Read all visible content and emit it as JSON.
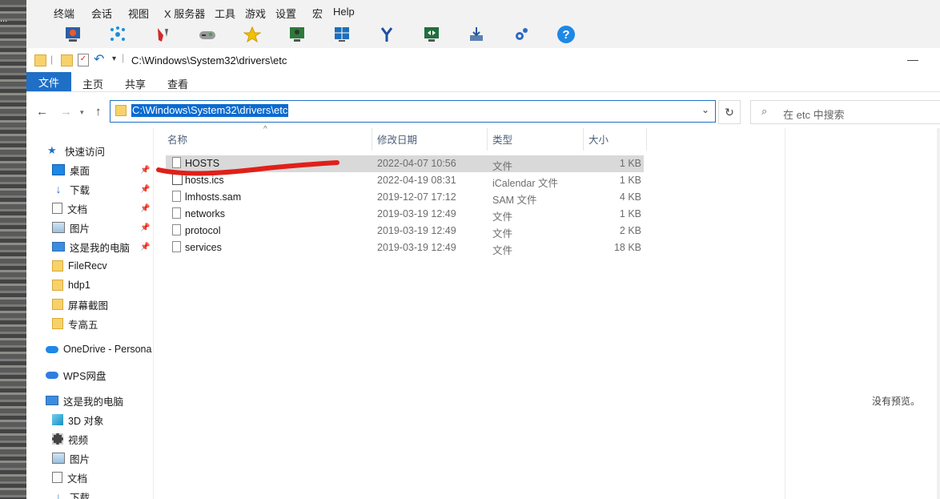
{
  "app_menu": [
    "终端",
    "会话",
    "视图",
    "X 服务器",
    "工具",
    "游戏",
    "设置",
    "宏",
    "Help"
  ],
  "app_toolbar_icons": [
    "session-icon",
    "network-icon",
    "tools-icon",
    "games-icon",
    "star-icon",
    "monitor-user-icon",
    "split-icon",
    "fork-icon",
    "remote-desktop-icon",
    "download-icon",
    "settings-icon",
    "help-icon"
  ],
  "window": {
    "title_path": "C:\\Windows\\System32\\drivers\\etc",
    "minimize_glyph": "—"
  },
  "ribbon": {
    "tabs": [
      "文件",
      "主页",
      "共享",
      "查看"
    ]
  },
  "address": {
    "path": "C:\\Windows\\System32\\drivers\\etc",
    "search_placeholder": "在 etc 中搜索"
  },
  "nav": {
    "quick_access": "快速访问",
    "quick_items": [
      {
        "label": "桌面",
        "icon": "desktop-icon",
        "pinned": true
      },
      {
        "label": "下载",
        "icon": "download-arrow-icon",
        "pinned": true
      },
      {
        "label": "文档",
        "icon": "document-icon",
        "pinned": true
      },
      {
        "label": "图片",
        "icon": "picture-icon",
        "pinned": true
      },
      {
        "label": "这是我的电脑",
        "icon": "computer-icon",
        "pinned": true
      },
      {
        "label": "FileRecv",
        "icon": "folder-icon",
        "pinned": false
      },
      {
        "label": "hdp1",
        "icon": "folder-icon",
        "pinned": false
      },
      {
        "label": "屏幕截图",
        "icon": "folder-icon",
        "pinned": false
      },
      {
        "label": "专高五",
        "icon": "folder-icon",
        "pinned": false
      }
    ],
    "onedrive": "OneDrive - Persona",
    "wps": "WPS网盘",
    "this_pc": "这是我的电脑",
    "pc_items": [
      {
        "label": "3D 对象",
        "icon": "cube-icon"
      },
      {
        "label": "视频",
        "icon": "video-icon"
      },
      {
        "label": "图片",
        "icon": "picture-icon"
      },
      {
        "label": "文档",
        "icon": "document-icon"
      },
      {
        "label": "下载",
        "icon": "download-arrow-icon"
      }
    ]
  },
  "columns": {
    "name": "名称",
    "date": "修改日期",
    "type": "类型",
    "size": "大小"
  },
  "files": [
    {
      "name": "HOSTS",
      "date": "2022-04-07 10:56",
      "type": "文件",
      "size": "1 KB",
      "selected": true
    },
    {
      "name": "hosts.ics",
      "date": "2022-04-19 08:31",
      "type": "iCalendar 文件",
      "size": "1 KB",
      "selected": false
    },
    {
      "name": "lmhosts.sam",
      "date": "2019-12-07 17:12",
      "type": "SAM 文件",
      "size": "4 KB",
      "selected": false
    },
    {
      "name": "networks",
      "date": "2019-03-19 12:49",
      "type": "文件",
      "size": "1 KB",
      "selected": false
    },
    {
      "name": "protocol",
      "date": "2019-03-19 12:49",
      "type": "文件",
      "size": "2 KB",
      "selected": false
    },
    {
      "name": "services",
      "date": "2019-03-19 12:49",
      "type": "文件",
      "size": "18 KB",
      "selected": false
    }
  ],
  "preview_text": "没有预览。",
  "colors": {
    "accent": "#1f6fc7",
    "selection": "#d9d9d9",
    "annotation": "#e0201a"
  }
}
